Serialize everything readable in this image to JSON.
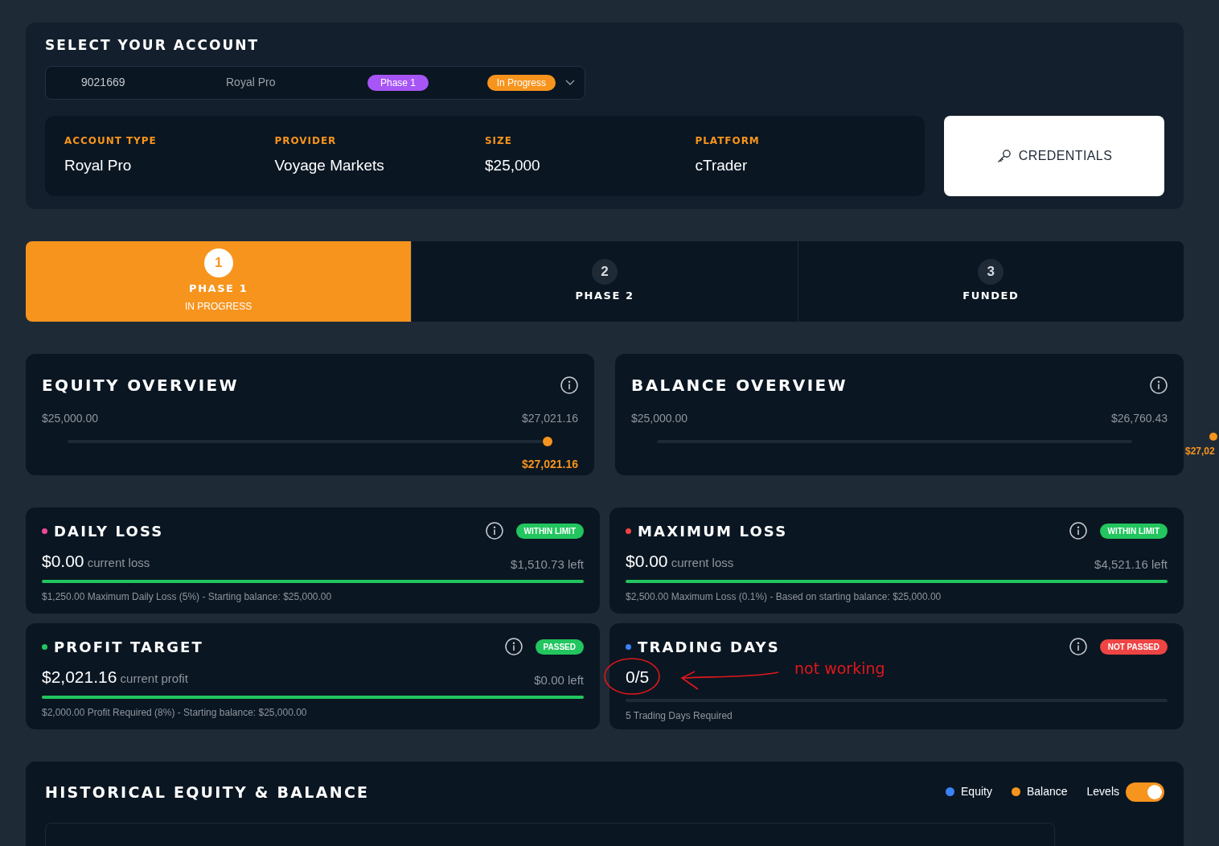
{
  "account_select": {
    "title": "SELECT YOUR ACCOUNT",
    "dropdown": {
      "number": "9021669",
      "name": "Royal Pro",
      "phase": "Phase 1",
      "status": "In Progress"
    },
    "details": [
      {
        "label": "ACCOUNT TYPE",
        "value": "Royal Pro"
      },
      {
        "label": "PROVIDER",
        "value": "Voyage Markets"
      },
      {
        "label": "SIZE",
        "value": "$25,000"
      },
      {
        "label": "PLATFORM",
        "value": "cTrader"
      }
    ],
    "credentials_button": "CREDENTIALS"
  },
  "phases": [
    {
      "number": "1",
      "label": "PHASE 1",
      "status": "IN PROGRESS",
      "selected": true
    },
    {
      "number": "2",
      "label": "PHASE 2",
      "selected": false
    },
    {
      "number": "3",
      "label": "FUNDED",
      "selected": false
    }
  ],
  "overviews": [
    {
      "title": "EQUITY OVERVIEW",
      "min": "$25,000.00",
      "max": "$27,021.16",
      "level": 1,
      "marker": "$27,021.16",
      "marker_outside": false
    },
    {
      "title": "BALANCE OVERVIEW",
      "min": "$25,000.00",
      "max": "$26,760.43",
      "marker": "$27,02",
      "marker_outside": true
    }
  ],
  "objectives": [
    {
      "title": "DAILY LOSS",
      "color": "#ec4899",
      "badge": "WITHIN LIMIT",
      "met": true,
      "value": "$0.00",
      "value_note": "current loss",
      "left": "$1,510.73 left",
      "level": 1,
      "note": "$1,250.00 Maximum Daily Loss (5%) - Starting balance: $25,000.00"
    },
    {
      "title": "MAXIMUM LOSS",
      "color": "#ef4444",
      "badge": "WITHIN LIMIT",
      "met": true,
      "value": "$0.00",
      "value_note": "current loss",
      "left": "$4,521.16 left",
      "level": 1,
      "note": "$2,500.00 Maximum Loss (0.1%) - Based on starting balance: $25,000.00"
    },
    {
      "title": "PROFIT TARGET",
      "color": "#22c55e",
      "badge": "PASSED",
      "met": true,
      "value": "$2,021.16",
      "value_note": "current profit",
      "left": "$0.00 left",
      "level": 1,
      "note": "$2,000.00 Profit Required (8%) - Starting balance: $25,000.00"
    },
    {
      "title": "TRADING DAYS",
      "color": "#3b82f6",
      "badge": "NOT PASSED",
      "met": false,
      "value": "0/5",
      "level": 0,
      "note": "5 Trading Days Required",
      "annotation": "not working"
    }
  ],
  "history": {
    "title": "HISTORICAL EQUITY & BALANCE",
    "legend": [
      {
        "label": "Equity",
        "color": "#3b82f6"
      },
      {
        "label": "Balance",
        "color": "#f7941d"
      }
    ],
    "levels_toggle": {
      "label": "Levels",
      "on": true
    }
  }
}
